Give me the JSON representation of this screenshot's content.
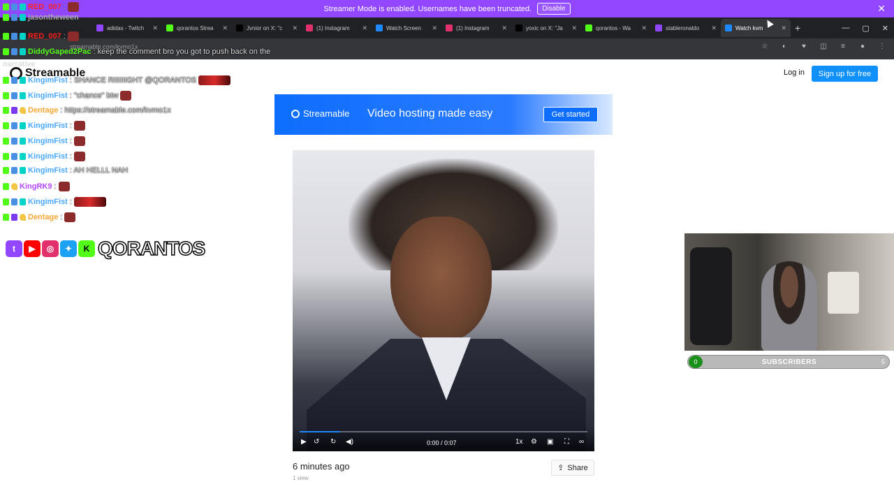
{
  "banner": {
    "text": "Streamer Mode is enabled. Usernames have been truncated.",
    "disable_label": "Disable"
  },
  "browser": {
    "tabs": [
      {
        "title": "adidas - Twitch",
        "color": "#9147ff"
      },
      {
        "title": "qorantos Strea",
        "color": "#53fc18"
      },
      {
        "title": "Jvnior on X: \"c",
        "color": "#000000"
      },
      {
        "title": "(1) Instagram",
        "color": "#e1306c"
      },
      {
        "title": "Watch Screen",
        "color": "#1e88ff"
      },
      {
        "title": "(1) Instagram",
        "color": "#e1306c"
      },
      {
        "title": "yoxic on X: \"Ja",
        "color": "#000000"
      },
      {
        "title": "qorantos - Wa",
        "color": "#53fc18"
      },
      {
        "title": "stableronaldo",
        "color": "#9147ff"
      },
      {
        "title": "Watch kvm",
        "color": "#1e88ff"
      }
    ],
    "url": "streamable.com/kvmo1x"
  },
  "chat": {
    "lines": [
      {
        "user": "RED_007",
        "msg": ":",
        "color": "#ff2020",
        "emote": true
      },
      {
        "user": "jasontheween",
        "msg": "",
        "color": "#aaaaaa",
        "emote": false
      },
      {
        "user": "RED_007",
        "msg": ":",
        "color": "#ff2020",
        "emote": true
      },
      {
        "user": "DiddyGaped2Pac",
        "msg": ": keep the comment bro you got to push back on the",
        "color": "#53fc18",
        "emote": false
      },
      {
        "user": "narrative",
        "msg": "",
        "color": "#dddddd",
        "emote": false
      },
      {
        "user": "KingimFist",
        "msg": ": SHANCE RIIIIIIGHT @QORANTOS",
        "color": "#4aa8ff",
        "emote": "wide"
      },
      {
        "user": "KingimFist",
        "msg": ": \"chance\" btw",
        "color": "#4aa8ff",
        "emote": true
      },
      {
        "user": "Dentage",
        "msg": ": https://streamable.com/kvmo1x",
        "color": "#f7a634",
        "emote": false
      },
      {
        "user": "KingimFist",
        "msg": ":",
        "color": "#4aa8ff",
        "emote": true
      },
      {
        "user": "KingimFist",
        "msg": ":",
        "color": "#4aa8ff",
        "emote": true
      },
      {
        "user": "KingimFist",
        "msg": ":",
        "color": "#4aa8ff",
        "emote": true
      },
      {
        "user": "KingimFist",
        "msg": ": AH HELLL NAH",
        "color": "#4aa8ff",
        "emote": false
      },
      {
        "user": "KingRK9",
        "msg": ":",
        "color": "#b447ff",
        "emote": true
      },
      {
        "user": "KingimFist",
        "msg": ":",
        "color": "#4aa8ff",
        "emote": "wide"
      },
      {
        "user": "Dentage",
        "msg": ":",
        "color": "#f7a634",
        "emote": true
      }
    ],
    "handle": "QORANTOS"
  },
  "site": {
    "logo": "Streamable",
    "login": "Log in",
    "signup": "Sign up for free"
  },
  "ad": {
    "logo": "Streamable",
    "tagline": "Video hosting made easy",
    "cta": "Get started"
  },
  "video": {
    "time": "0:00 / 0:07",
    "speed": "1x",
    "progress": 0.14,
    "posted": "6 minutes ago",
    "views": "1 view",
    "share": "Share"
  },
  "overlay": {
    "subs_count": "0",
    "subs_label": "SUBSCRIBERS",
    "subs_goal": "5"
  }
}
